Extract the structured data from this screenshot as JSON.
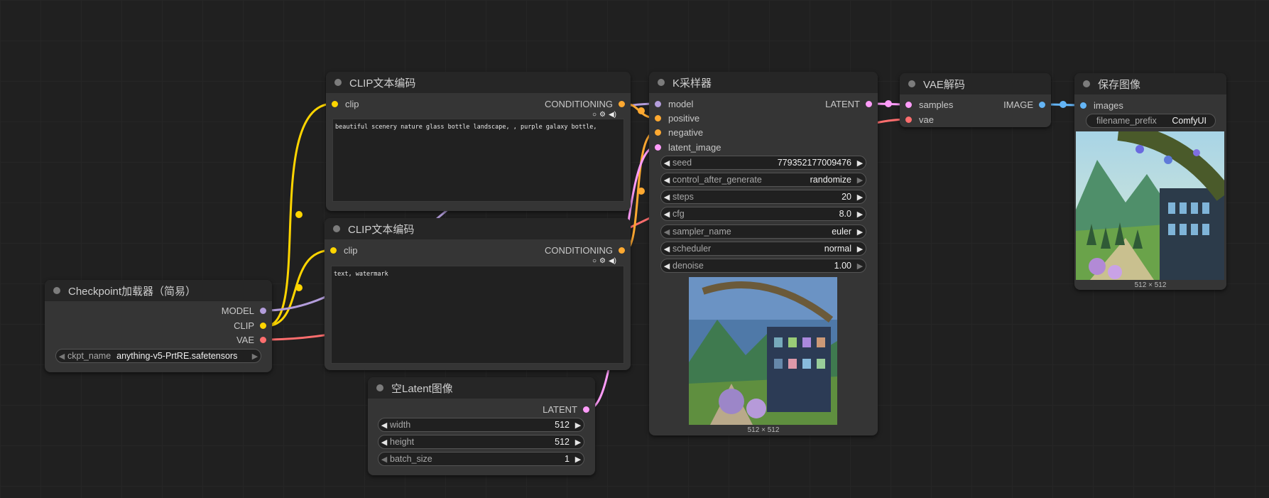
{
  "colors": {
    "model": "#b39ddb",
    "clip": "#ffd500",
    "vae": "#ff6e6e",
    "conditioning": "#ffa931",
    "latent": "#ff9cf9",
    "image": "#64b5f6"
  },
  "checkpoint": {
    "title": "Checkpoint加载器（简易）",
    "outputs": [
      "MODEL",
      "CLIP",
      "VAE"
    ],
    "ckpt_label": "ckpt_name",
    "ckpt_value": "anything-v5-PrtRE.safetensors"
  },
  "clip_pos": {
    "title": "CLIP文本编码",
    "input": "clip",
    "output": "CONDITIONING",
    "text": "beautiful scenery nature glass bottle landscape, , purple galaxy bottle,"
  },
  "clip_neg": {
    "title": "CLIP文本编码",
    "input": "clip",
    "output": "CONDITIONING",
    "text": "text, watermark"
  },
  "empty_latent": {
    "title": "空Latent图像",
    "output": "LATENT",
    "widgets": [
      {
        "label": "width",
        "value": "512"
      },
      {
        "label": "height",
        "value": "512"
      },
      {
        "label": "batch_size",
        "value": "1"
      }
    ]
  },
  "ksampler": {
    "title": "K采样器",
    "inputs": [
      "model",
      "positive",
      "negative",
      "latent_image"
    ],
    "output": "LATENT",
    "widgets": [
      {
        "label": "seed",
        "value": "779352177009476"
      },
      {
        "label": "control_after_generate",
        "value": "randomize"
      },
      {
        "label": "steps",
        "value": "20"
      },
      {
        "label": "cfg",
        "value": "8.0"
      },
      {
        "label": "sampler_name",
        "value": "euler"
      },
      {
        "label": "scheduler",
        "value": "normal"
      },
      {
        "label": "denoise",
        "value": "1.00"
      }
    ],
    "preview_caption": "512 × 512"
  },
  "vae_decode": {
    "title": "VAE解码",
    "inputs": [
      "samples",
      "vae"
    ],
    "output": "IMAGE"
  },
  "save_image": {
    "title": "保存图像",
    "input": "images",
    "prefix_label": "filename_prefix",
    "prefix_value": "ComfyUI",
    "caption": "512 × 512"
  }
}
